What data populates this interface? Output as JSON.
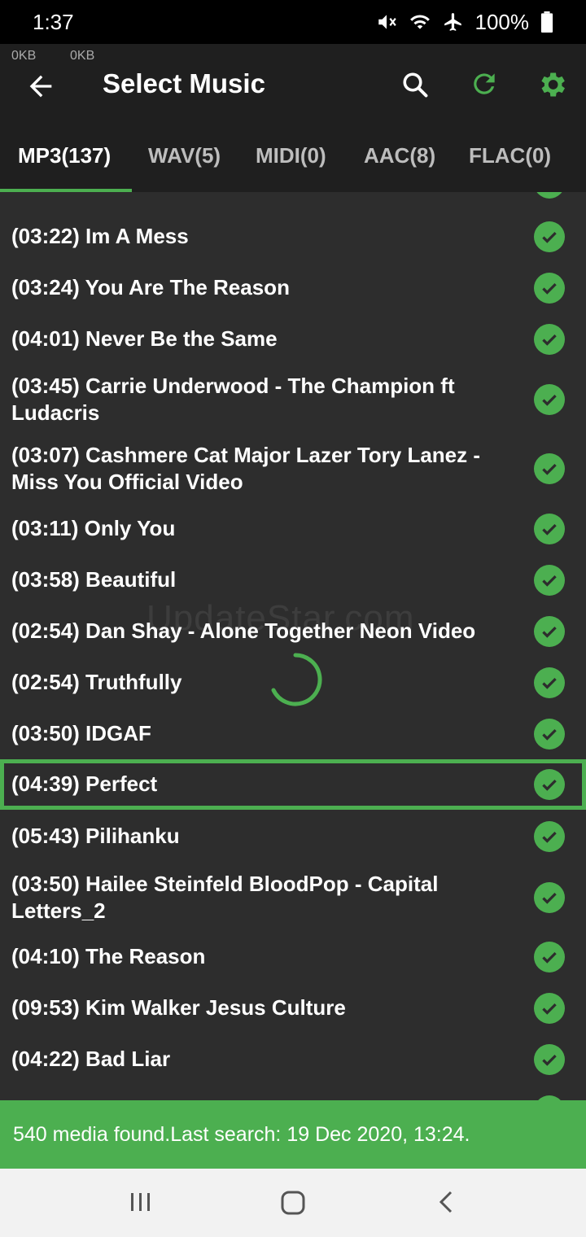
{
  "status_bar": {
    "time": "1:37",
    "battery": "100%"
  },
  "app_bar": {
    "upload_speed": "0KB",
    "download_speed": "0KB",
    "title": "Select Music"
  },
  "tabs": [
    {
      "label": "MP3(137)"
    },
    {
      "label": "WAV(5)"
    },
    {
      "label": "MIDI(0)"
    },
    {
      "label": "AAC(8)"
    },
    {
      "label": "FLAC(0)"
    }
  ],
  "songs": [
    {
      "label": "(03:22) Im A Mess"
    },
    {
      "label": "(03:24) You Are The Reason"
    },
    {
      "label": "(04:01) Never Be the Same"
    },
    {
      "label": "(03:45) Carrie Underwood - The Champion ft Ludacris"
    },
    {
      "label": "(03:07) Cashmere Cat Major Lazer Tory Lanez - Miss You Official Video"
    },
    {
      "label": "(03:11) Only You"
    },
    {
      "label": "(03:58) Beautiful"
    },
    {
      "label": "(02:54) Dan  Shay - Alone Together Neon Video"
    },
    {
      "label": "(02:54) Truthfully"
    },
    {
      "label": "(03:50) IDGAF"
    },
    {
      "label": "(04:39) Perfect"
    },
    {
      "label": "(05:43) Pilihanku"
    },
    {
      "label": "(03:50) Hailee Steinfeld BloodPop - Capital Letters_2"
    },
    {
      "label": "(04:10) The Reason"
    },
    {
      "label": "(09:53) Kim Walker Jesus Culture"
    },
    {
      "label": "(04:22) Bad Liar"
    }
  ],
  "selected_song": "(04:39) Perfect",
  "watermark": "UpdateStar.com",
  "footer": {
    "message": "540 media found.Last search: 19 Dec 2020, 13:24."
  },
  "colors": {
    "accent": "#4caf50",
    "background": "#2d2d2d",
    "app_bar": "#1f1f1f"
  }
}
